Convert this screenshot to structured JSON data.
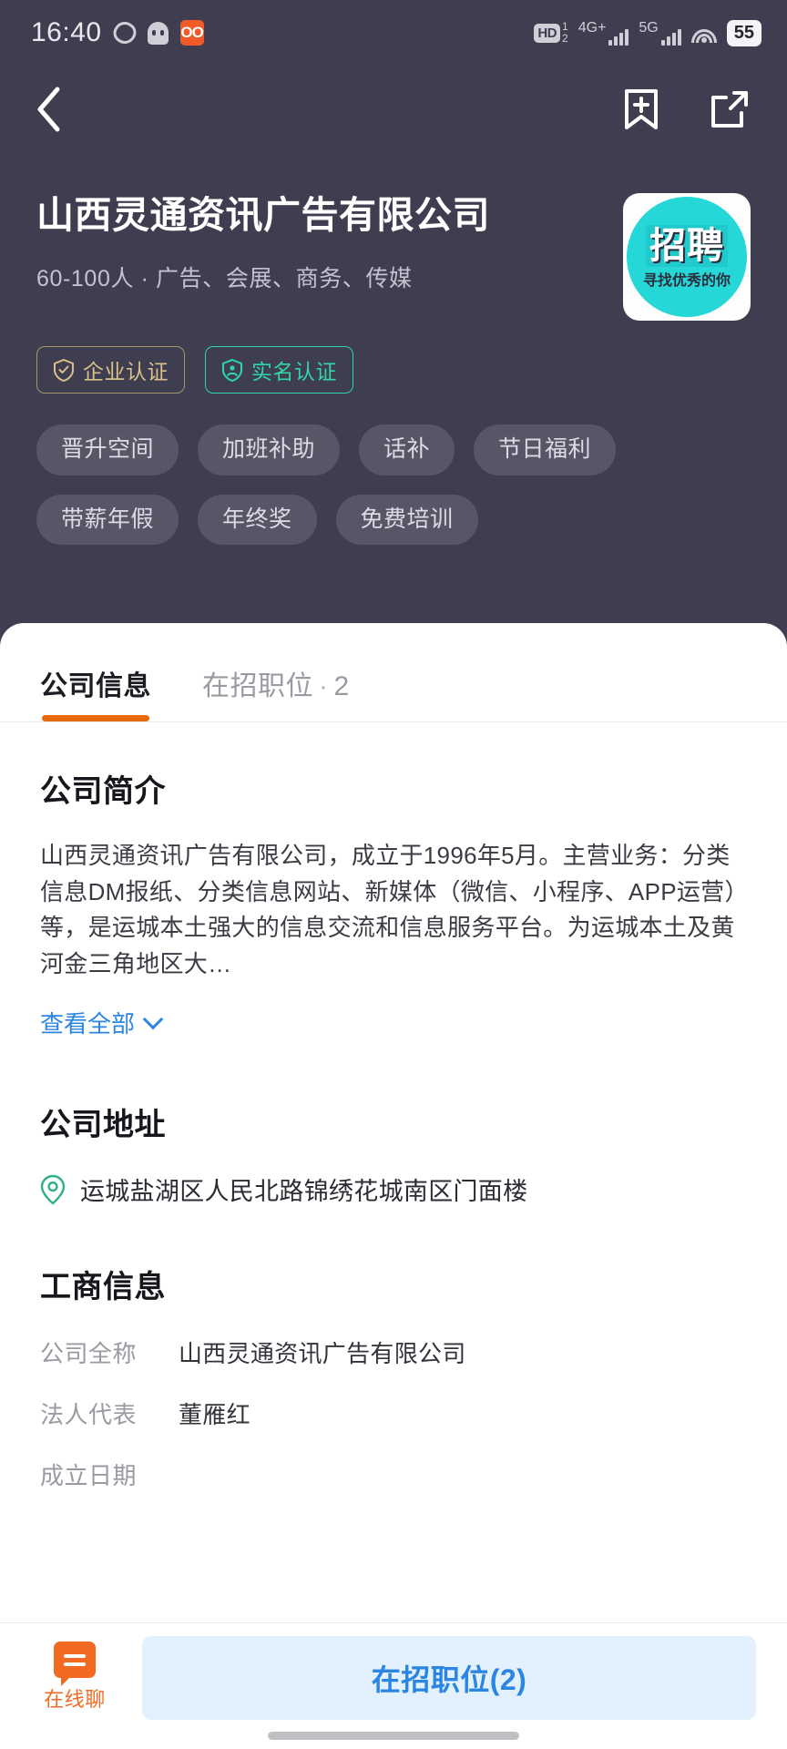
{
  "statusbar": {
    "time": "16:40",
    "oo_badge": "OO",
    "hd_label": "HD",
    "sim1": "1",
    "sim2": "2",
    "net1": "4G+",
    "net2": "5G",
    "battery": "55"
  },
  "navbar": {
    "back": "back-arrow",
    "bookmark": "bookmark-add",
    "share": "share"
  },
  "header": {
    "company_name": "山西灵通资讯广告有限公司",
    "meta": "60-100人 · 广告、会展、商务、传媒",
    "logo": {
      "main": "招聘",
      "sub": "寻找优秀的你"
    },
    "badges": [
      {
        "label": "企业认证",
        "color": "#d9c08a"
      },
      {
        "label": "实名认证",
        "color": "#2fd6a6"
      }
    ],
    "tags": [
      "晋升空间",
      "加班补助",
      "话补",
      "节日福利",
      "带薪年假",
      "年终奖",
      "免费培训"
    ]
  },
  "tabs": [
    {
      "label": "公司信息",
      "active": true
    },
    {
      "label": "在招职位",
      "separator": "·",
      "count": "2",
      "active": false
    }
  ],
  "intro": {
    "title": "公司简介",
    "body": "山西灵通资讯广告有限公司，成立于1996年5月。主营业务：分类信息DM报纸、分类信息网站、新媒体（微信、小程序、APP运营）等，是运城本土强大的信息交流和信息服务平台。为运城本土及黄河金三角地区大…",
    "view_all": "查看全部"
  },
  "address": {
    "title": "公司地址",
    "value": "运城盐湖区人民北路锦绣花城南区门面楼"
  },
  "business": {
    "title": "工商信息",
    "rows": [
      {
        "key": "公司全称",
        "value": "山西灵通资讯广告有限公司"
      },
      {
        "key": "法人代表",
        "value": "董雁红"
      },
      {
        "key": "成立日期",
        "value": ""
      }
    ]
  },
  "bottombar": {
    "chat_label": "在线聊",
    "jobs_label": "在招职位(2)"
  },
  "colors": {
    "header_bg": "#3e3e50",
    "accent_orange": "#e8690d",
    "link_blue": "#2b86e3",
    "logo_teal": "#25d7d7"
  }
}
